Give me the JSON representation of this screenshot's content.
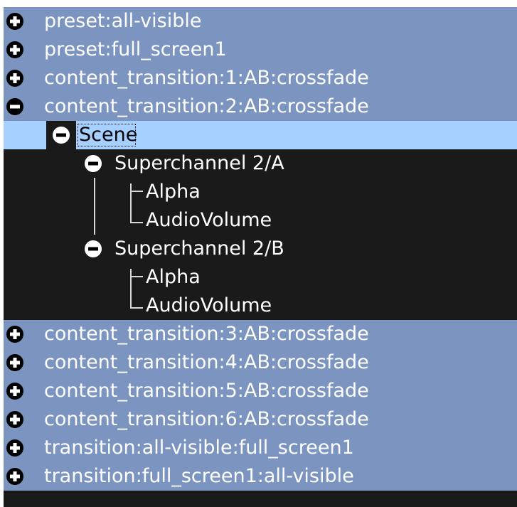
{
  "colors": {
    "top_row_bg": "#7c94c0",
    "selected_row_bg": "#a5d0ff",
    "tree_bg": "#1a1a1a",
    "text": "#ffffff"
  },
  "tree": {
    "rows": [
      {
        "label": "preset:all-visible",
        "state": "collapsed",
        "icon": "plus-circle-icon"
      },
      {
        "label": "preset:full_screen1",
        "state": "collapsed",
        "icon": "plus-circle-icon"
      },
      {
        "label": "content_transition:1:AB:crossfade",
        "state": "collapsed",
        "icon": "plus-circle-icon"
      },
      {
        "label": "content_transition:2:AB:crossfade",
        "state": "expanded",
        "icon": "minus-circle-icon"
      },
      {
        "label": "content_transition:3:AB:crossfade",
        "state": "collapsed",
        "icon": "plus-circle-icon"
      },
      {
        "label": "content_transition:4:AB:crossfade",
        "state": "collapsed",
        "icon": "plus-circle-icon"
      },
      {
        "label": "content_transition:5:AB:crossfade",
        "state": "collapsed",
        "icon": "plus-circle-icon"
      },
      {
        "label": "content_transition:6:AB:crossfade",
        "state": "collapsed",
        "icon": "plus-circle-icon"
      },
      {
        "label": "transition:all-visible:full_screen1",
        "state": "collapsed",
        "icon": "plus-circle-icon"
      },
      {
        "label": "transition:full_screen1:all-visible",
        "state": "collapsed",
        "icon": "plus-circle-icon"
      }
    ],
    "scene": {
      "label": "Scene",
      "state": "expanded",
      "selected": true,
      "channels": [
        {
          "label": "Superchannel 2/A",
          "state": "expanded",
          "params": [
            "Alpha",
            "AudioVolume"
          ]
        },
        {
          "label": "Superchannel 2/B",
          "state": "expanded",
          "params": [
            "Alpha",
            "AudioVolume"
          ]
        }
      ]
    }
  }
}
